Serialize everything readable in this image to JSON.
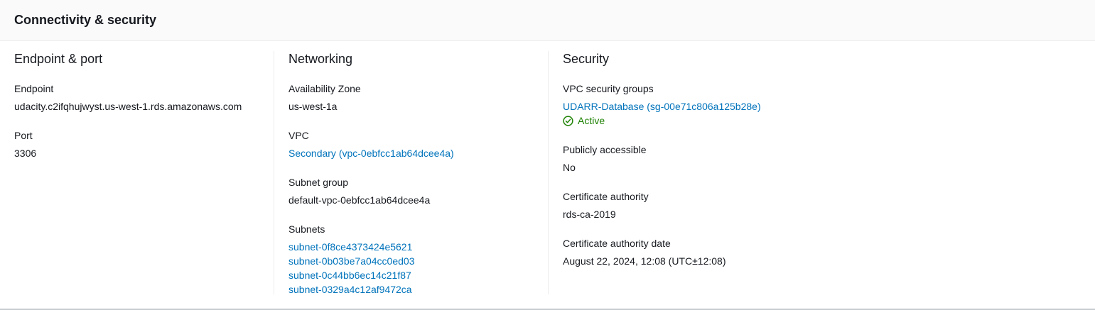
{
  "panel": {
    "title": "Connectivity & security"
  },
  "endpoint_port": {
    "heading": "Endpoint & port",
    "endpoint_label": "Endpoint",
    "endpoint_value": "udacity.c2ifqhujwyst.us-west-1.rds.amazonaws.com",
    "port_label": "Port",
    "port_value": "3306"
  },
  "networking": {
    "heading": "Networking",
    "az_label": "Availability Zone",
    "az_value": "us-west-1a",
    "vpc_label": "VPC",
    "vpc_value": "Secondary (vpc-0ebfcc1ab64dcee4a)",
    "subnet_group_label": "Subnet group",
    "subnet_group_value": "default-vpc-0ebfcc1ab64dcee4a",
    "subnets_label": "Subnets",
    "subnets": [
      "subnet-0f8ce4373424e5621",
      "subnet-0b03be7a04cc0ed03",
      "subnet-0c44bb6ec14c21f87",
      "subnet-0329a4c12af9472ca"
    ]
  },
  "security": {
    "heading": "Security",
    "vpc_sg_label": "VPC security groups",
    "vpc_sg_value": "UDARR-Database (sg-00e71c806a125b28e)",
    "vpc_sg_status": "Active",
    "public_label": "Publicly accessible",
    "public_value": "No",
    "ca_label": "Certificate authority",
    "ca_value": "rds-ca-2019",
    "ca_date_label": "Certificate authority date",
    "ca_date_value": "August 22, 2024, 12:08 (UTC±12:08)"
  },
  "colors": {
    "link": "#0073bb",
    "status_active": "#1d8102",
    "text": "#16191f",
    "header_bg": "#fafafa",
    "divider": "#eaeded"
  },
  "icons": {
    "status": "check-circle-icon"
  }
}
